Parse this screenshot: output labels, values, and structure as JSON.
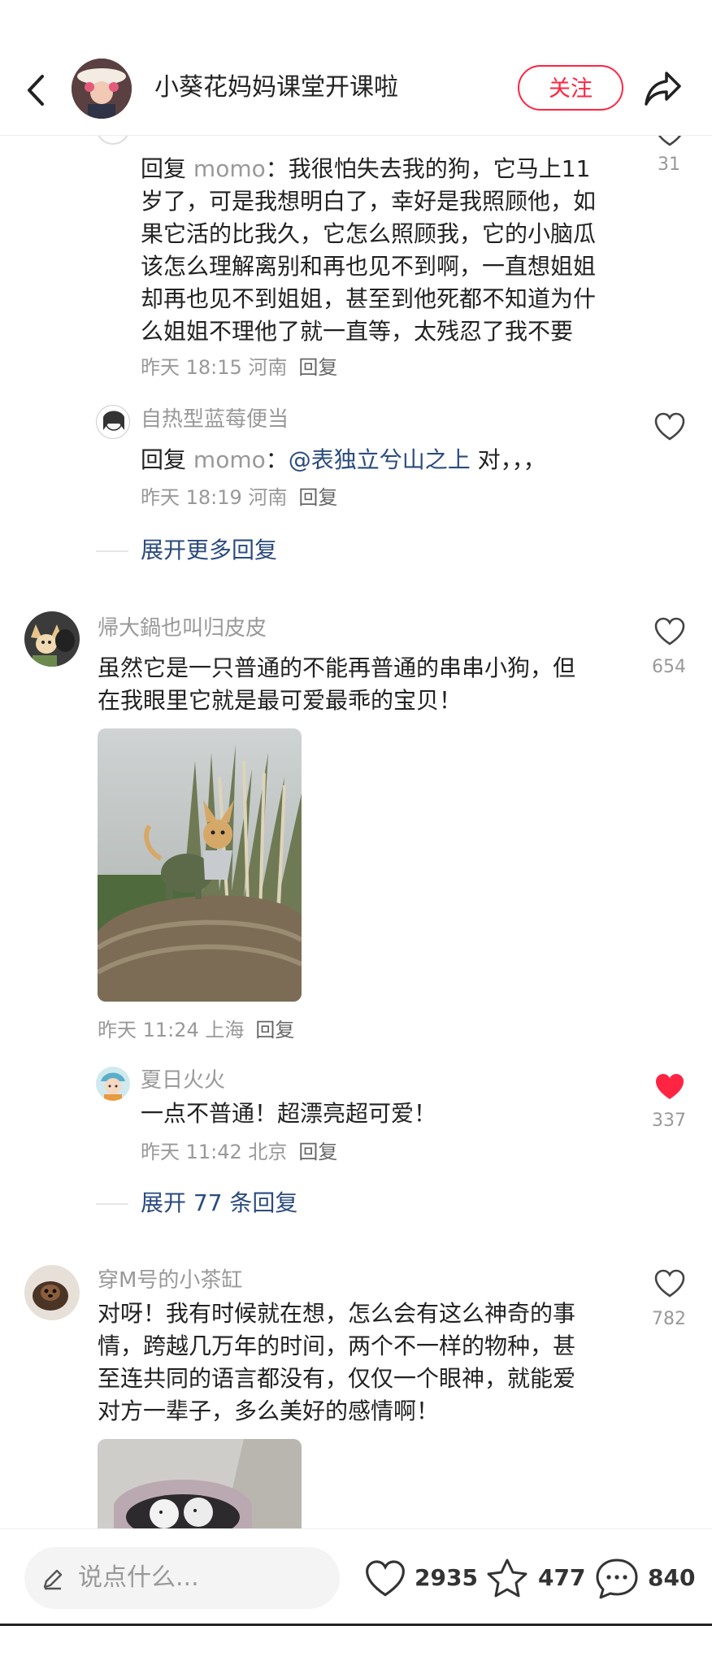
{
  "header": {
    "title": "小葵花妈妈课堂开课啦",
    "follow_label": "关注"
  },
  "comments": {
    "c1": {
      "reply_word": "回复",
      "reply_to": "momo",
      "colon": "：",
      "line1": "我很怕失去我的狗，它马上11",
      "line2": "岁了，可是我想明白了，幸好是我照顾他，如",
      "line3": "果它活的比我久，它怎么照顾我，它的小脑瓜",
      "line4": "该怎么理解离别和再也见不到啊，一直想姐姐",
      "line5": "却再也见不到姐姐，甚至到他死都不知道为什",
      "line6": "么姐姐不理他了就一直等，太残忍了我不要",
      "meta": "昨天 18:15 河南",
      "reply_label": "回复",
      "likes": "31"
    },
    "c2": {
      "username": "自热型蓝莓便当",
      "reply_word": "回复",
      "reply_to": "momo",
      "colon": "：",
      "mention": "@表独立兮山之上",
      "text": " 对，，，",
      "meta": "昨天 18:19 河南",
      "reply_label": "回复"
    },
    "expand1": "展开更多回复",
    "c3": {
      "username": "帰大鍋也叫归皮皮",
      "line1": "虽然它是一只普通的不能再普通的串串小狗，但",
      "line2": "在我眼里它就是最可爱最乖的宝贝！",
      "meta": "昨天 11:24 上海",
      "reply_label": "回复",
      "likes": "654"
    },
    "c4": {
      "username": "夏日火火",
      "text": "一点不普通！超漂亮超可爱！",
      "meta": "昨天 11:42 北京",
      "reply_label": "回复",
      "likes": "337"
    },
    "expand2": "展开 77 条回复",
    "c5": {
      "username": "穿M号的小茶缸",
      "line1": "对呀！我有时候就在想，怎么会有这么神奇的事",
      "line2": "情，跨越几万年的时间，两个不一样的物种，甚",
      "line3": "至连共同的语言都没有，仅仅一个眼神，就能爱",
      "line4": "对方一辈子，多么美好的感情啊！",
      "likes": "782"
    }
  },
  "bottom": {
    "placeholder": "说点什么...",
    "likes": "2935",
    "collects": "477",
    "comments": "840"
  },
  "colors": {
    "accent": "#ff2442",
    "link": "#2b4b7e",
    "muted": "#999999"
  }
}
